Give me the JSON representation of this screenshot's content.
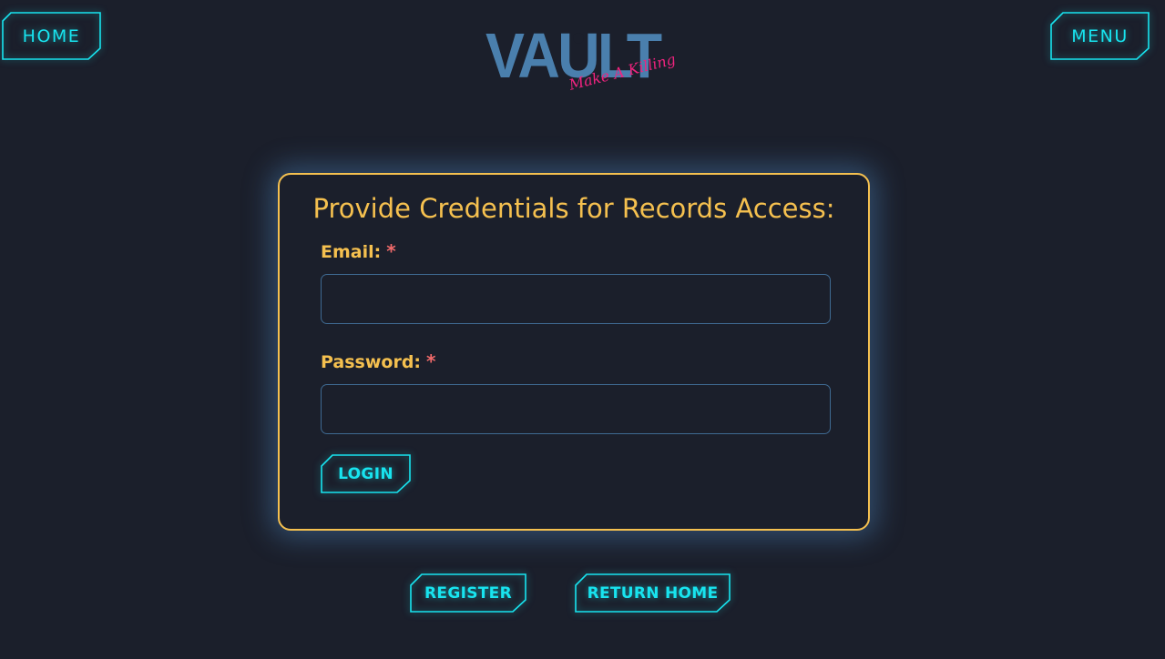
{
  "nav": {
    "home_label": "HOME",
    "menu_label": "MENU"
  },
  "logo": {
    "word": "VAULT",
    "tagline": "Make A Killing",
    "icon": "keyhole-icon"
  },
  "login_form": {
    "title": "Provide Credentials for Records Access:",
    "email_label": "Email:",
    "email_required_mark": "*",
    "email_value": "",
    "password_label": "Password:",
    "password_required_mark": "*",
    "password_value": "",
    "login_label": "LOGIN"
  },
  "footer_actions": {
    "register_label": "REGISTER",
    "return_home_label": "RETURN HOME"
  },
  "colors": {
    "background": "#1b1f2b",
    "accent_gold": "#f5c04f",
    "neon_cyan": "#18e4ef",
    "logo_blue": "#4a7fad",
    "logo_pink": "#f0237f",
    "required_red": "#f06a6a",
    "input_border": "#3f6a92"
  }
}
